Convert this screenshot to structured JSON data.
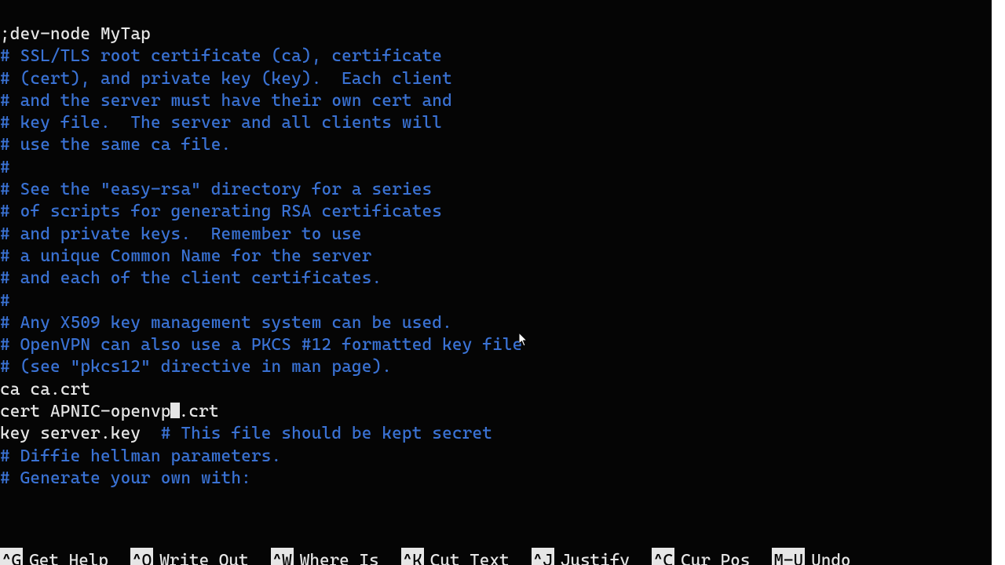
{
  "editor": {
    "lines": [
      {
        "cls": "pl",
        "text": ";dev-node MyTap"
      },
      {
        "cls": "pl",
        "text": ""
      },
      {
        "cls": "cm",
        "text": "# SSL/TLS root certificate (ca), certificate"
      },
      {
        "cls": "cm",
        "text": "# (cert), and private key (key).  Each client"
      },
      {
        "cls": "cm",
        "text": "# and the server must have their own cert and"
      },
      {
        "cls": "cm",
        "text": "# key file.  The server and all clients will"
      },
      {
        "cls": "cm",
        "text": "# use the same ca file."
      },
      {
        "cls": "cm",
        "text": "#"
      },
      {
        "cls": "cm",
        "text": "# See the \"easy-rsa\" directory for a series"
      },
      {
        "cls": "cm",
        "text": "# of scripts for generating RSA certificates"
      },
      {
        "cls": "cm",
        "text": "# and private keys.  Remember to use"
      },
      {
        "cls": "cm",
        "text": "# a unique Common Name for the server"
      },
      {
        "cls": "cm",
        "text": "# and each of the client certificates."
      },
      {
        "cls": "cm",
        "text": "#"
      },
      {
        "cls": "cm",
        "text": "# Any X509 key management system can be used."
      },
      {
        "cls": "cm",
        "text": "# OpenVPN can also use a PKCS #12 formatted key file"
      },
      {
        "cls": "cm",
        "text": "# (see \"pkcs12\" directive in man page)."
      },
      {
        "cls": "pl",
        "text": "ca ca.crt"
      },
      {
        "cls": "pl",
        "text": "cert APNIC-openvp",
        "cursor_after": true,
        "text_after": ".crt"
      },
      {
        "cls": "pl",
        "text": "key server.key  ",
        "trail_cm": "# This file should be kept secret"
      },
      {
        "cls": "pl",
        "text": ""
      },
      {
        "cls": "cm",
        "text": "# Diffie hellman parameters."
      },
      {
        "cls": "cm",
        "text": "# Generate your own with:"
      }
    ]
  },
  "helpbar": {
    "items": [
      {
        "key": "^G",
        "label": "Get Help"
      },
      {
        "key": "^O",
        "label": "Write Out"
      },
      {
        "key": "^W",
        "label": "Where Is"
      },
      {
        "key": "^K",
        "label": "Cut Text"
      },
      {
        "key": "^J",
        "label": "Justify"
      },
      {
        "key": "^C",
        "label": "Cur Pos"
      },
      {
        "key": "M-U",
        "label": "Undo"
      }
    ]
  }
}
